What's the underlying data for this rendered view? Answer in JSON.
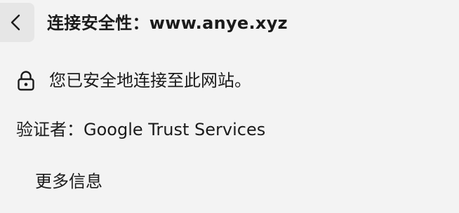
{
  "header": {
    "title": "连接安全性：www.anye.xyz",
    "back_icon": "chevron-left-icon"
  },
  "status": {
    "icon": "lock-icon",
    "text": "您已安全地连接至此网站。"
  },
  "verifier": {
    "text": "验证者：Google Trust Services"
  },
  "more_info": {
    "label": "更多信息"
  }
}
